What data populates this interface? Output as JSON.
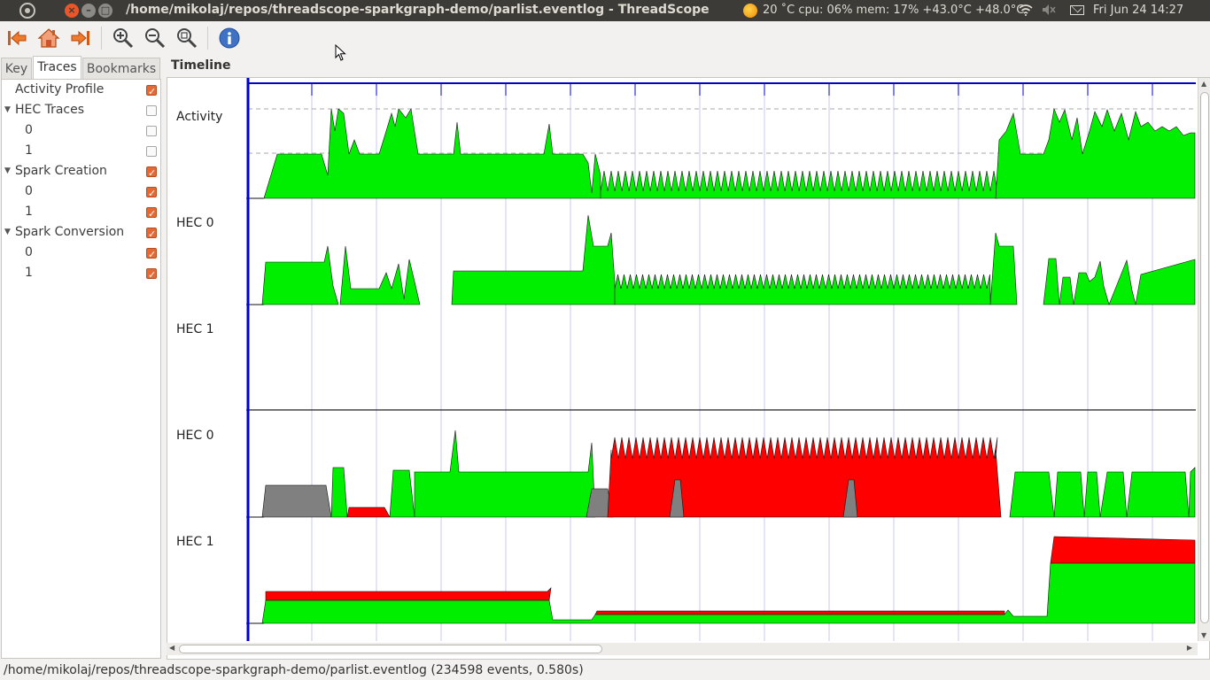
{
  "window": {
    "title": "/home/mikolaj/repos/threadscope-sparkgraph-demo/parlist.eventlog - ThreadScope",
    "close_glyph": "×",
    "min_glyph": "–",
    "max_glyph": "□"
  },
  "system_tray": {
    "weather": "20 ˚C  cpu: 06% mem: 17% +43.0°C +48.0°C",
    "clock": "Fri Jun 24 14:27",
    "icons": [
      "weather-sun-icon",
      "wifi-icon",
      "volume-muted-icon",
      "mail-icon"
    ]
  },
  "toolbar": {
    "buttons": [
      {
        "name": "jump-to-start-button",
        "icon": "arrow-left-bar-icon"
      },
      {
        "name": "home-button",
        "icon": "home-icon"
      },
      {
        "name": "jump-to-end-button",
        "icon": "arrow-right-bar-icon"
      },
      {
        "name": "zoom-in-button",
        "icon": "zoom-in-icon"
      },
      {
        "name": "zoom-out-button",
        "icon": "zoom-out-icon"
      },
      {
        "name": "zoom-fit-button",
        "icon": "zoom-fit-icon"
      },
      {
        "name": "about-button",
        "icon": "info-icon"
      }
    ]
  },
  "sidebar": {
    "tabs": [
      {
        "label": "Key",
        "active": false
      },
      {
        "label": "Traces",
        "active": true
      },
      {
        "label": "Bookmarks",
        "active": false
      }
    ],
    "tree": [
      {
        "label": "Activity Profile",
        "level": 0,
        "expander": false,
        "checked": true
      },
      {
        "label": "HEC Traces",
        "level": 0,
        "expander": true,
        "checked": false
      },
      {
        "label": "0",
        "level": 1,
        "expander": false,
        "checked": false
      },
      {
        "label": "1",
        "level": 1,
        "expander": false,
        "checked": false
      },
      {
        "label": "Spark Creation",
        "level": 0,
        "expander": true,
        "checked": true
      },
      {
        "label": "0",
        "level": 1,
        "expander": false,
        "checked": true
      },
      {
        "label": "1",
        "level": 1,
        "expander": false,
        "checked": true
      },
      {
        "label": "Spark Conversion",
        "level": 0,
        "expander": true,
        "checked": true
      },
      {
        "label": "0",
        "level": 1,
        "expander": false,
        "checked": true
      },
      {
        "label": "1",
        "level": 1,
        "expander": false,
        "checked": true
      }
    ]
  },
  "timeline": {
    "title": "Timeline",
    "trace_labels": [
      "Activity",
      "HEC 0",
      "HEC 1",
      "HEC 0",
      "HEC 1"
    ],
    "colors": {
      "axis": "#0000cc",
      "gridline": "#c8c8f0",
      "green": "#00ee00",
      "red": "#ff0000",
      "grey": "#808080"
    }
  },
  "status": {
    "text": "/home/mikolaj/repos/threadscope-sparkgraph-demo/parlist.eventlog (234598 events, 0.580s)"
  }
}
